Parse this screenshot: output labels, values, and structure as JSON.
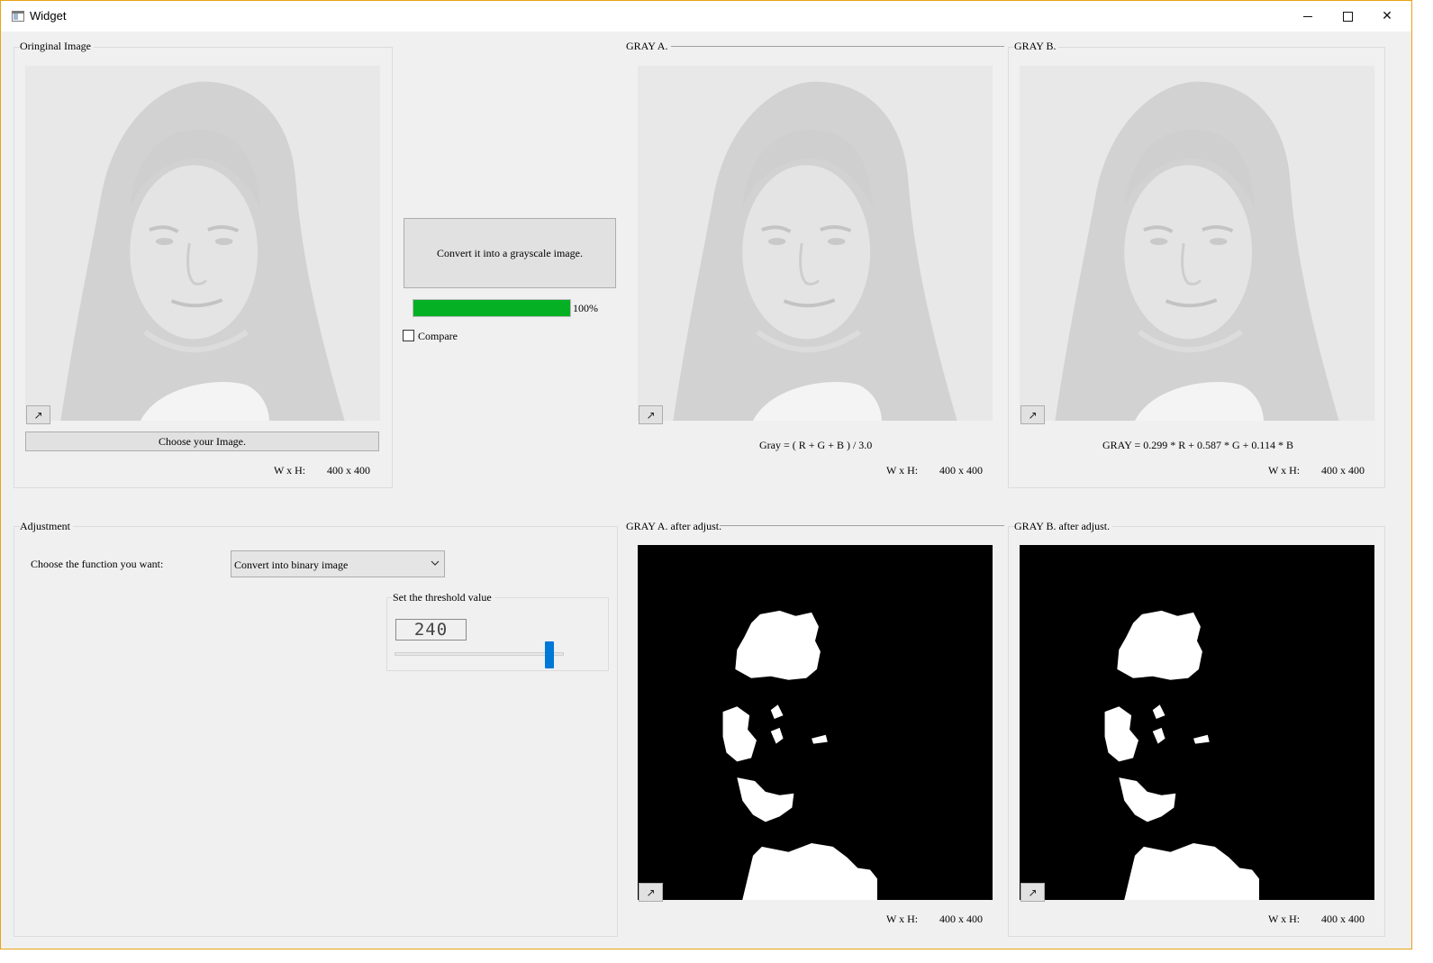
{
  "window": {
    "title": "Widget"
  },
  "original": {
    "group_title": "Oringinal Image",
    "choose_button": "Choose your Image.",
    "wh_label": "W x H:",
    "wh_value": "400 x 400"
  },
  "convert": {
    "button_label": "Convert it into a grayscale image.",
    "progress_percent": 100,
    "progress_text": "100%",
    "compare_label": "Compare",
    "compare_checked": false
  },
  "gray_a": {
    "group_title": "GRAY A.",
    "formula": "Gray = ( R + G + B ) / 3.0",
    "wh_label": "W x H:",
    "wh_value": "400 x 400"
  },
  "gray_b": {
    "group_title": "GRAY B.",
    "formula": "GRAY = 0.299 * R + 0.587 * G + 0.114 * B",
    "wh_label": "W x H:",
    "wh_value": "400 x 400"
  },
  "adjustment": {
    "group_title": "Adjustment",
    "function_label": "Choose the function you want:",
    "function_value": "Convert into binary image",
    "threshold_group_title": "Set the threshold value",
    "threshold_value": "240",
    "slider_fraction": 0.94
  },
  "gray_a_adjusted": {
    "group_title": "GRAY A. after adjust.",
    "wh_label": "W x H:",
    "wh_value": "400 x 400"
  },
  "gray_b_adjusted": {
    "group_title": "GRAY B. after adjust.",
    "wh_label": "W x H:",
    "wh_value": "400 x 400"
  },
  "icons": {
    "zoom": "expand-arrow-icon",
    "close": "close-icon",
    "minimize": "minimize-icon",
    "maximize": "maximize-icon"
  },
  "colors": {
    "progress": "#06b025",
    "slider_handle": "#0078d7",
    "window_border": "#e8a317"
  }
}
